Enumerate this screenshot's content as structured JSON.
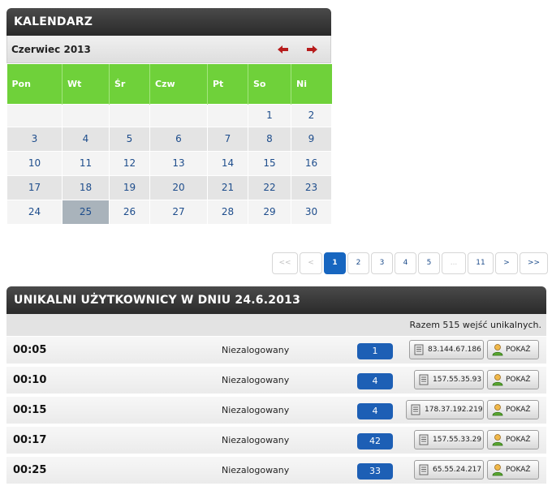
{
  "calendar": {
    "header": "KALENDARZ",
    "month_label": "Czerwiec 2013",
    "weekdays": [
      "Pon",
      "Wt",
      "Śr",
      "Czw",
      "Pt",
      "So",
      "Ni"
    ],
    "weeks": [
      [
        "",
        "",
        "",
        "",
        "",
        "1",
        "2"
      ],
      [
        "3",
        "4",
        "5",
        "6",
        "7",
        "8",
        "9"
      ],
      [
        "10",
        "11",
        "12",
        "13",
        "14",
        "15",
        "16"
      ],
      [
        "17",
        "18",
        "19",
        "20",
        "21",
        "22",
        "23"
      ],
      [
        "24",
        "25",
        "26",
        "27",
        "28",
        "29",
        "30"
      ]
    ],
    "selected_day": "25",
    "colors": {
      "header_green": "#6fd13a",
      "today": "#a9b3bb",
      "arrow_red": "#b71c1c"
    }
  },
  "pager": {
    "first": "<<",
    "prev": "<",
    "pages": [
      "1",
      "2",
      "3",
      "4",
      "5",
      "...",
      "11"
    ],
    "current": "1",
    "next": ">",
    "last": ">>"
  },
  "users": {
    "header": "UNIKALNI UŻYTKOWNICY W DNIU 24.6.2013",
    "summary": "Razem 515 wejść unikalnych.",
    "show_label": "POKAŻ",
    "rows": [
      {
        "time": "00:05",
        "status": "Niezalogowany",
        "count": "1",
        "ip": "83.144.67.186"
      },
      {
        "time": "00:10",
        "status": "Niezalogowany",
        "count": "4",
        "ip": "157.55.35.93"
      },
      {
        "time": "00:15",
        "status": "Niezalogowany",
        "count": "4",
        "ip": "178.37.192.219"
      },
      {
        "time": "00:17",
        "status": "Niezalogowany",
        "count": "42",
        "ip": "157.55.33.29"
      },
      {
        "time": "00:25",
        "status": "Niezalogowany",
        "count": "33",
        "ip": "65.55.24.217"
      }
    ],
    "icons": {
      "ip": "document-icon",
      "show": "user-icon"
    },
    "colors": {
      "count_badge": "#1d5fb5"
    }
  }
}
